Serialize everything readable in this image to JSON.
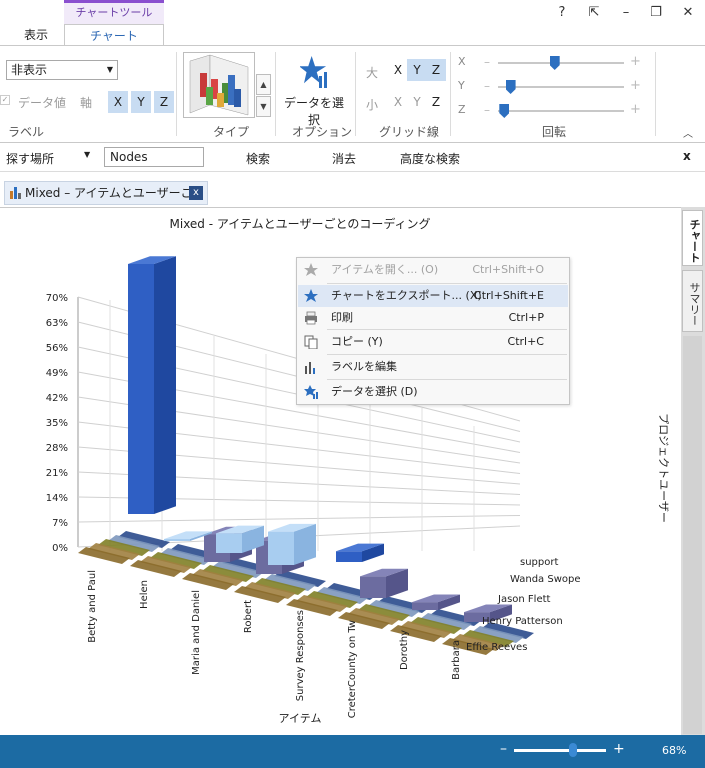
{
  "ribbon_tabs": {
    "context_header": "チャートツール",
    "display": "表示",
    "chart": "チャート"
  },
  "window_controls": {
    "help": "?",
    "restore_pane": "⇱",
    "minimize": "–",
    "maximize": "❐",
    "close": "✕"
  },
  "ribbon": {
    "label_group": {
      "dropdown_value": "非表示",
      "data_value": "データ値",
      "axis": "軸",
      "axes": [
        "X",
        "Y",
        "Z"
      ],
      "title": "ラベル"
    },
    "type_group": {
      "title": "タイプ"
    },
    "option_group": {
      "select_data": "データを選択",
      "title": "オプション"
    },
    "grid_group": {
      "large": "大",
      "small": "小",
      "axes": [
        "X",
        "Y",
        "Z"
      ],
      "title": "グリッド線"
    },
    "rotation_group": {
      "axes": [
        "X",
        "Y",
        "Z"
      ],
      "minus": "–",
      "plus": "+",
      "title": "回転",
      "levels": [
        0.45,
        0.1,
        0.05
      ]
    }
  },
  "find_bar": {
    "look_in": "探す場所",
    "field": "Nodes",
    "find": "検索",
    "clear": "消去",
    "advanced": "高度な検索",
    "close": "x"
  },
  "doc_tab": {
    "title": "Mixed – アイテムとユーザーごと",
    "close": "x"
  },
  "side_tabs": {
    "chart": "チャート",
    "summary": "サマリー"
  },
  "context_menu": [
    {
      "label": "アイテムを開く... (O)",
      "shortcut": "Ctrl+Shift+O",
      "icon": "open-item-icon",
      "disabled": true
    },
    {
      "label": "チャートをエクスポート... (X)",
      "shortcut": "Ctrl+Shift+E",
      "icon": "export-icon",
      "hover": true
    },
    {
      "label": "印刷",
      "shortcut": "Ctrl+P",
      "icon": "print-icon"
    },
    {
      "label": "コピー (Y)",
      "shortcut": "Ctrl+C",
      "icon": "copy-icon"
    },
    {
      "label": "ラベルを編集",
      "shortcut": "",
      "icon": "edit-labels-icon"
    },
    {
      "label": "データを選択 (D)",
      "shortcut": "",
      "icon": "select-data-icon"
    }
  ],
  "status_bar": {
    "zoom": "68%",
    "zoom_fraction": 0.68
  },
  "colors": {
    "accent": "#2c6fc0",
    "status": "#1c6ba3",
    "context": "#8a4fcf"
  },
  "chart_data": {
    "type": "bar3d",
    "title": "Mixed - アイテムとユーザーごとのコーディング",
    "xlabel": "アイテム",
    "zlabel": "プロジェクトユーザー",
    "ylim": [
      0,
      70
    ],
    "yticks": [
      "0%",
      "7%",
      "14%",
      "21%",
      "28%",
      "35%",
      "42%",
      "49%",
      "56%",
      "63%",
      "70%"
    ],
    "categories": [
      "Betty and Paul",
      "Helen",
      "Maria and Daniel",
      "Robert",
      "Survey Responses",
      "CreterCounty on Tw",
      "Dorothy",
      "Barbara"
    ],
    "series": [
      {
        "name": "Effie Reeves",
        "values": [
          70,
          0,
          0,
          0,
          3,
          0,
          0,
          0
        ]
      },
      {
        "name": "Henry Patterson",
        "values": [
          0,
          0,
          0,
          0,
          0,
          0,
          0,
          0
        ]
      },
      {
        "name": "Jason Flett",
        "values": [
          0,
          0,
          0,
          0,
          0,
          0,
          0,
          0
        ]
      },
      {
        "name": "Wanda Swope",
        "values": [
          0,
          1,
          10,
          17,
          0,
          0,
          0,
          0
        ]
      },
      {
        "name": "support",
        "values": [
          0,
          0,
          14,
          17,
          0,
          11,
          4,
          5
        ]
      }
    ]
  }
}
